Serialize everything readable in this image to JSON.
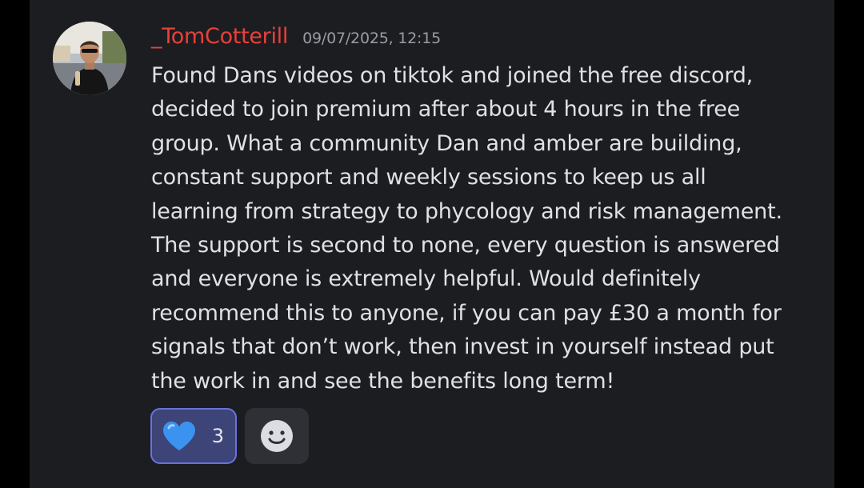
{
  "message": {
    "author": "_TomCotterill",
    "timestamp": "09/07/2025, 12:15",
    "lines": [
      "Found Dans videos on tiktok and joined the free discord,",
      "decided to join premium after about 4 hours in the free",
      "group. What a community Dan and amber are building,",
      "constant support and weekly sessions to keep us all",
      "learning from strategy to phycology  and risk management.",
      "The support is second to none, every question is answered",
      "and everyone is extremely helpful. Would definitely",
      "recommend this to anyone, if you can pay £30 a month for",
      "signals that don’t work, then invest in yourself instead put",
      "the work in and see the benefits long term!"
    ]
  },
  "reactions": [
    {
      "icon": "blue-heart-icon",
      "count": "3",
      "selected": true
    }
  ],
  "colors": {
    "background": "#1c1d21",
    "username": "#e8413a",
    "timestamp": "#9a9ba3",
    "text": "#e0e1e5",
    "reaction_selected_bg": "#3d4477",
    "reaction_selected_border": "#6a72d9",
    "heart": "#3b93f0"
  }
}
